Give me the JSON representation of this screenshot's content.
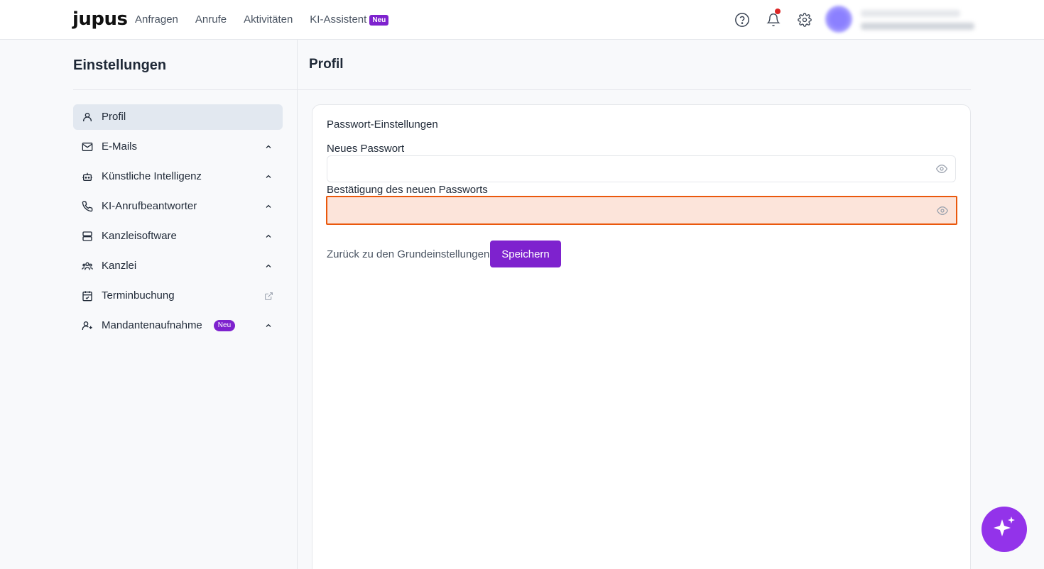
{
  "header": {
    "logo": "jupus",
    "nav": [
      {
        "label": "Anfragen"
      },
      {
        "label": "Anrufe"
      },
      {
        "label": "Aktivitäten"
      },
      {
        "label": "KI-Assistent",
        "badge": "Neu"
      }
    ],
    "icons": [
      "help-circle-icon",
      "bell-icon",
      "gear-icon"
    ]
  },
  "sidebar": {
    "title": "Einstellungen",
    "items": [
      {
        "label": "Profil",
        "icon": "user-icon",
        "active": true
      },
      {
        "label": "E-Mails",
        "icon": "mail-icon"
      },
      {
        "label": "Künstliche Intelligenz",
        "icon": "robot-icon"
      },
      {
        "label": "KI-Anrufbeantworter",
        "icon": "phone-icon"
      },
      {
        "label": "Kanzleisoftware",
        "icon": "server-icon"
      },
      {
        "label": "Kanzlei",
        "icon": "users-icon"
      },
      {
        "label": "Terminbuchung",
        "icon": "calendar-check-icon"
      },
      {
        "label": "Mandantenaufnahme",
        "icon": "user-plus-icon",
        "badge": "Neu"
      }
    ]
  },
  "main": {
    "title": "Profil",
    "card": {
      "title": "Passwort-Einstellungen",
      "new_password_label": "Neues Passwort",
      "new_password_value": "",
      "confirm_password_label": "Bestätigung des neuen Passworts",
      "confirm_password_value": "",
      "back_link": "Zurück zu den Grundeinstellungen",
      "save_label": "Speichern"
    }
  },
  "colors": {
    "accent": "#7e22ce",
    "error_border": "#ea580c",
    "error_bg": "#fce4da",
    "active_bg": "#e2e8f0",
    "fab": "#9333ea"
  }
}
